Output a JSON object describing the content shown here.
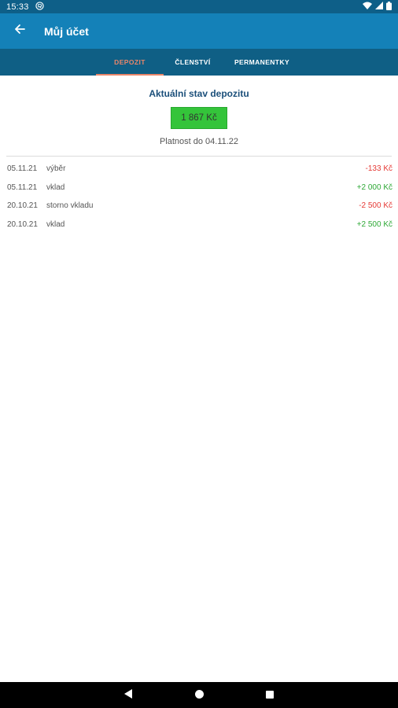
{
  "status_bar": {
    "time": "15:33"
  },
  "app_bar": {
    "title": "Můj účet"
  },
  "tabs": [
    {
      "label": "DEPOZIT",
      "active": true
    },
    {
      "label": "ČLENSTVÍ",
      "active": false
    },
    {
      "label": "PERMANENTKY",
      "active": false
    }
  ],
  "deposit": {
    "heading": "Aktuální stav depozitu",
    "balance": "1 867 Kč",
    "validity": "Platnost do 04.11.22"
  },
  "transactions": [
    {
      "date": "05.11.21",
      "description": "výběr",
      "amount": "-133 Kč",
      "type": "negative"
    },
    {
      "date": "05.11.21",
      "description": "vklad",
      "amount": "+2 000 Kč",
      "type": "positive"
    },
    {
      "date": "20.10.21",
      "description": "storno vkladu",
      "amount": "-2 500 Kč",
      "type": "negative"
    },
    {
      "date": "20.10.21",
      "description": "vklad",
      "amount": "+2 500 Kč",
      "type": "positive"
    }
  ],
  "colors": {
    "app_bar": "#1481b8",
    "tab_bar": "#0f5f85",
    "active_tab": "#e9866a",
    "balance_box": "#34c43a",
    "negative": "#e53935",
    "positive": "#2ea836"
  },
  "icons": {
    "back": "arrow-left-icon",
    "wifi": "wifi-icon",
    "signal": "cell-signal-icon",
    "battery": "battery-icon",
    "nav_back": "triangle-back-icon",
    "nav_home": "circle-home-icon",
    "nav_recent": "square-recents-icon"
  }
}
